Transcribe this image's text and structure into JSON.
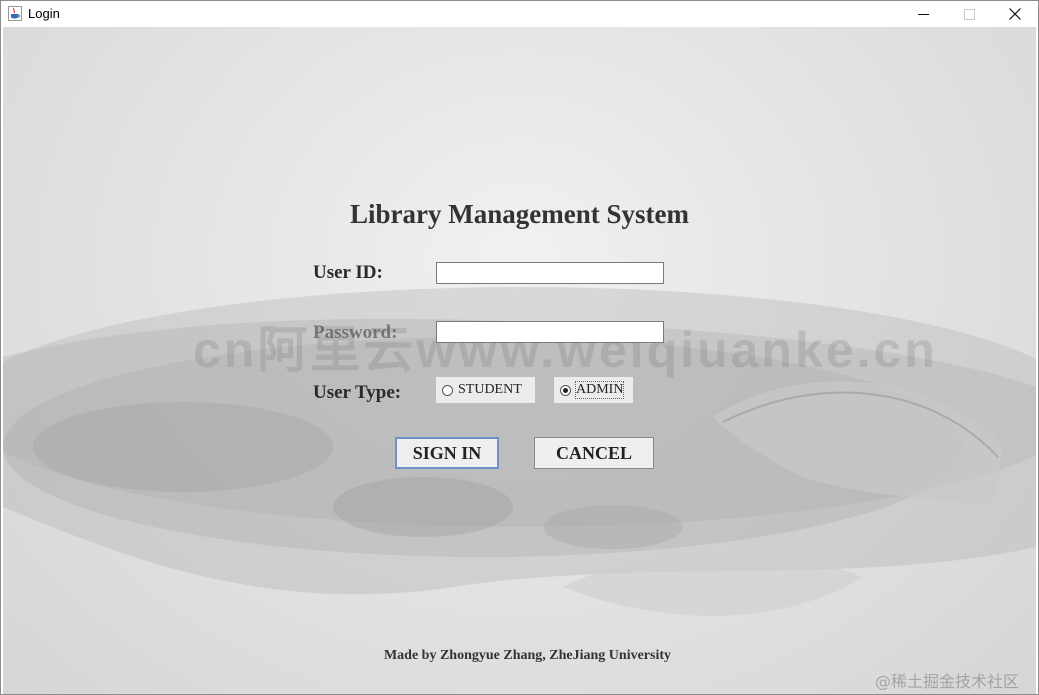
{
  "window": {
    "title": "Login",
    "controls": {
      "minimize": "minimize-icon",
      "maximize": "maximize-icon",
      "close": "close-icon"
    }
  },
  "form": {
    "heading": "Library Management System",
    "user_id_label": "User ID:",
    "user_id_value": "",
    "password_label": "Password:",
    "password_value": "",
    "user_type_label": "User Type:",
    "user_types": [
      {
        "label": "STUDENT",
        "selected": false
      },
      {
        "label": "ADMIN",
        "selected": true
      }
    ],
    "sign_in_label": "SIGN IN",
    "cancel_label": "CANCEL"
  },
  "watermark_text": "cn阿里云www.weiqiuanke.cn",
  "footer": "Made by Zhongyue Zhang, ZheJiang University",
  "corner_watermark": "@稀土掘金技术社区",
  "colors": {
    "accent_border": "#6d93c7",
    "background": "#dedede"
  }
}
